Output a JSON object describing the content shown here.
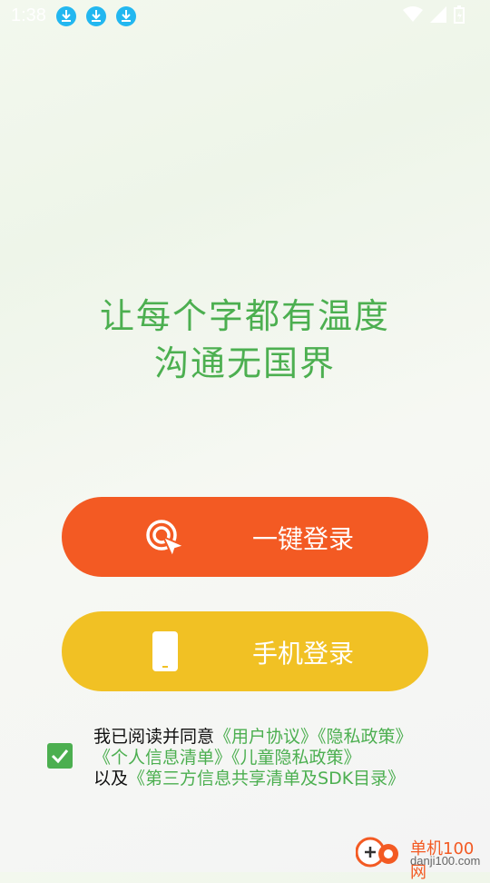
{
  "status": {
    "time": "1:38"
  },
  "slogan": {
    "line1": "让每个字都有温度",
    "line2": "沟通无国界"
  },
  "buttons": {
    "onekey_label": "一键登录",
    "phone_label": "手机登录"
  },
  "agreement": {
    "prefix": "我已阅读并同意",
    "user_agreement": "《用户协议》",
    "privacy_policy": "《隐私政策》",
    "personal_info": "《个人信息清单》",
    "child_privacy": "《儿童隐私政策》",
    "and": "以及",
    "third_party": "《第三方信息共享清单及SDK目录》",
    "checked": true
  },
  "watermark": {
    "name": "单机100网",
    "url": "danji100.com"
  },
  "colors": {
    "accent_green": "#4caf50",
    "onekey_orange": "#f35a23",
    "phone_yellow": "#f1c124"
  }
}
